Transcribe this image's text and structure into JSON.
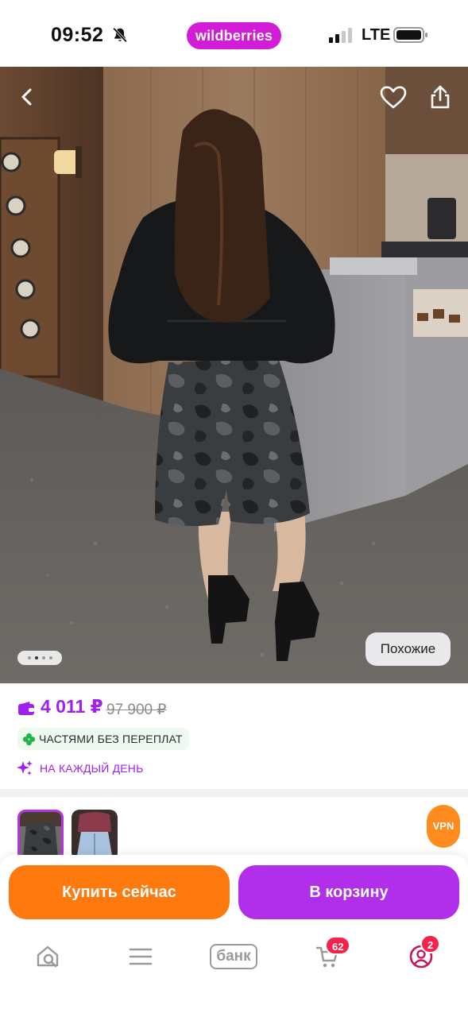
{
  "status_bar": {
    "time": "09:52",
    "brand": "wildberries",
    "network": "LTE",
    "icons": [
      "bell-off-icon",
      "signal-icon",
      "battery-icon"
    ]
  },
  "gallery": {
    "page_count": 4,
    "active_page": 2,
    "similar_label": "Похожие",
    "icons": [
      "back-icon",
      "heart-icon",
      "share-icon"
    ]
  },
  "price": {
    "current": "4 011 ₽",
    "old": "97 900 ₽",
    "installments": "ЧАСТЯМИ БЕЗ ПЕРЕПЛАТ",
    "daily": "НА КАЖДЫЙ ДЕНЬ"
  },
  "variants": {
    "count": 2,
    "selected_index": 0,
    "vpn_label": "VPN"
  },
  "actions": {
    "buy_now": "Купить сейчас",
    "add_to_cart": "В корзину"
  },
  "bottom_nav": {
    "bank_label": "банк",
    "cart_badge": "62",
    "profile_badge": "2"
  },
  "colors": {
    "brand": "#d21cd8",
    "price": "#a020f0",
    "buy_now": "#ff7a0e",
    "add_to_cart": "#b12eeb",
    "badge": "#f5234b"
  }
}
